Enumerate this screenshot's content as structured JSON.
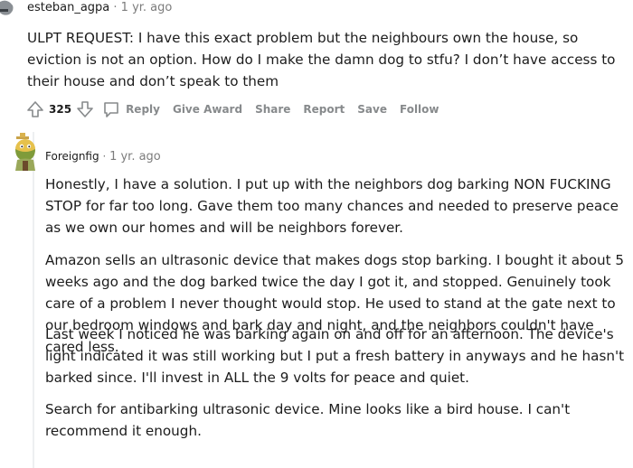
{
  "comment1": {
    "author": "esteban_agpa",
    "time": "1 yr. ago",
    "body": "ULPT REQUEST: I have this exact problem but the neighbours own the house, so eviction is not an option. How do I make the damn dog to stfu? I don’t have access to their house and don’t speak to them",
    "score": "325",
    "actions": {
      "reply": "Reply",
      "give_award": "Give Award",
      "share": "Share",
      "report": "Report",
      "save": "Save",
      "follow": "Follow"
    }
  },
  "comment2": {
    "author": "Foreignfig",
    "time": "1 yr. ago",
    "paragraphs": [
      "Honestly, I have a solution. I put up with the neighbors dog barking NON FUCKING STOP for far too long. Gave them too many chances and needed to preserve peace as we own our homes and will be neighbors forever.",
      "Amazon sells an ultrasonic device that makes dogs stop barking. I bought it about 5 weeks ago and the dog barked twice the day I got it, and stopped. Genuinely took care of a problem I never thought would stop. He used to stand at the gate next to our bedroom windows and bark day and night, and the neighbors couldn't have cared less.",
      "Last week I noticed he was barking again on and off for an afternoon. The device's light indicated it was still working but I put a fresh battery in anyways and he hasn't barked since. I'll invest in ALL the 9 volts for peace and quiet.",
      "Search for antibarking ultrasonic device. Mine looks like a bird house. I can't recommend it enough."
    ]
  },
  "colors": {
    "text": "#1c1c1c",
    "meta": "#7c7c7c",
    "action": "#878a8c",
    "thread": "#edeff1"
  }
}
